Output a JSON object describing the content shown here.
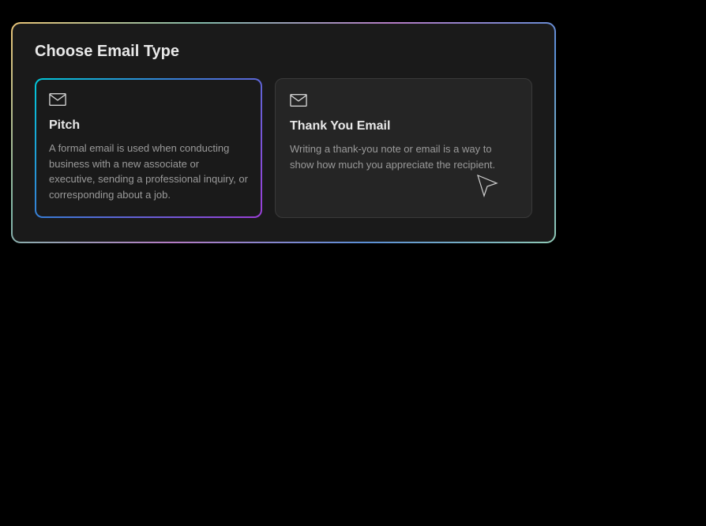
{
  "panel": {
    "title": "Choose Email Type"
  },
  "cards": [
    {
      "title": "Pitch",
      "description": "A formal email is used when conducting business with a new associate or executive, sending a professional inquiry, or corresponding about a job."
    },
    {
      "title": "Thank You Email",
      "description": "Writing a thank-you note or email is a way to show how much you appreciate the recipient."
    }
  ]
}
